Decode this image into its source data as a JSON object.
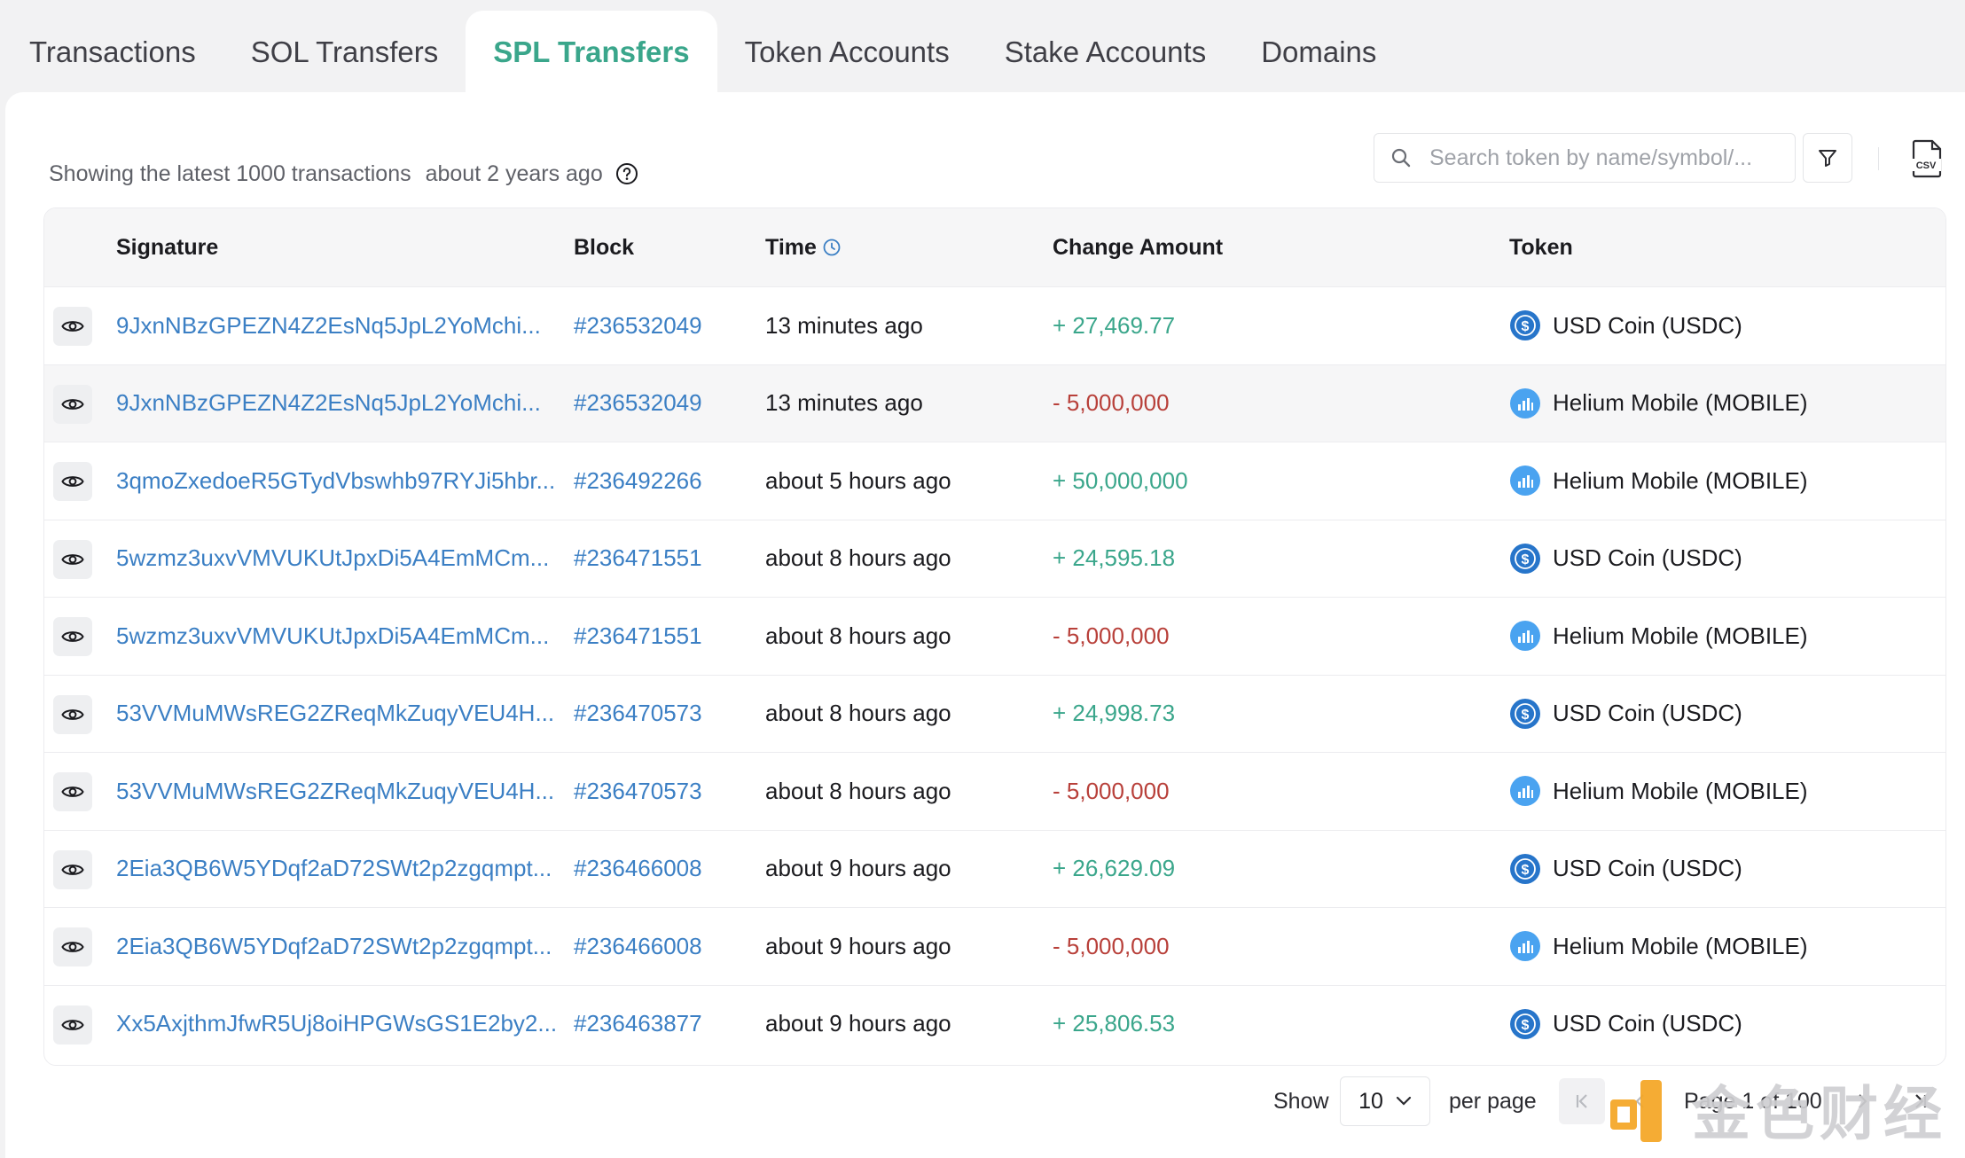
{
  "tabs": [
    {
      "label": "Transactions",
      "active": false
    },
    {
      "label": "SOL Transfers",
      "active": false
    },
    {
      "label": "SPL Transfers",
      "active": true
    },
    {
      "label": "Token Accounts",
      "active": false
    },
    {
      "label": "Stake Accounts",
      "active": false
    },
    {
      "label": "Domains",
      "active": false
    }
  ],
  "info": {
    "showing_text": "Showing the latest 1000 transactions",
    "ago_text": "about 2 years ago"
  },
  "search": {
    "placeholder": "Search token by name/symbol/..."
  },
  "table": {
    "headers": {
      "signature": "Signature",
      "block": "Block",
      "time": "Time",
      "change_amount": "Change Amount",
      "token": "Token"
    },
    "rows": [
      {
        "signature": "9JxnNBzGPEZN4Z2EsNq5JpL2YoMchi...",
        "block": "#236532049",
        "time": "13 minutes ago",
        "change": "+ 27,469.77",
        "direction": "positive",
        "token": "USD Coin (USDC)",
        "token_icon": "usdc-icon"
      },
      {
        "signature": "9JxnNBzGPEZN4Z2EsNq5JpL2YoMchi...",
        "block": "#236532049",
        "time": "13 minutes ago",
        "change": "- 5,000,000",
        "direction": "negative",
        "token": "Helium Mobile (MOBILE)",
        "token_icon": "helium-mobile-icon"
      },
      {
        "signature": "3qmoZxedoeR5GTydVbswhb97RYJi5hbr...",
        "block": "#236492266",
        "time": "about 5 hours ago",
        "change": "+ 50,000,000",
        "direction": "positive",
        "token": "Helium Mobile (MOBILE)",
        "token_icon": "helium-mobile-icon"
      },
      {
        "signature": "5wzmz3uxvVMVUKUtJpxDi5A4EmMCm...",
        "block": "#236471551",
        "time": "about 8 hours ago",
        "change": "+ 24,595.18",
        "direction": "positive",
        "token": "USD Coin (USDC)",
        "token_icon": "usdc-icon"
      },
      {
        "signature": "5wzmz3uxvVMVUKUtJpxDi5A4EmMCm...",
        "block": "#236471551",
        "time": "about 8 hours ago",
        "change": "- 5,000,000",
        "direction": "negative",
        "token": "Helium Mobile (MOBILE)",
        "token_icon": "helium-mobile-icon"
      },
      {
        "signature": "53VVMuMWsREG2ZReqMkZuqyVEU4H...",
        "block": "#236470573",
        "time": "about 8 hours ago",
        "change": "+ 24,998.73",
        "direction": "positive",
        "token": "USD Coin (USDC)",
        "token_icon": "usdc-icon"
      },
      {
        "signature": "53VVMuMWsREG2ZReqMkZuqyVEU4H...",
        "block": "#236470573",
        "time": "about 8 hours ago",
        "change": "- 5,000,000",
        "direction": "negative",
        "token": "Helium Mobile (MOBILE)",
        "token_icon": "helium-mobile-icon"
      },
      {
        "signature": "2Eia3QB6W5YDqf2aD72SWt2p2zgqmpt...",
        "block": "#236466008",
        "time": "about 9 hours ago",
        "change": "+ 26,629.09",
        "direction": "positive",
        "token": "USD Coin (USDC)",
        "token_icon": "usdc-icon"
      },
      {
        "signature": "2Eia3QB6W5YDqf2aD72SWt2p2zgqmpt...",
        "block": "#236466008",
        "time": "about 9 hours ago",
        "change": "- 5,000,000",
        "direction": "negative",
        "token": "Helium Mobile (MOBILE)",
        "token_icon": "helium-mobile-icon"
      },
      {
        "signature": "Xx5AxjthmJfwR5Uj8oiHPGWsGS1E2by2...",
        "block": "#236463877",
        "time": "about 9 hours ago",
        "change": "+ 25,806.53",
        "direction": "positive",
        "token": "USD Coin (USDC)",
        "token_icon": "usdc-icon"
      }
    ]
  },
  "pagination": {
    "show_label": "Show",
    "per_page_value": "10",
    "per_page_label": "per page",
    "page_text": "Page 1 of 100"
  },
  "watermark": {
    "text": "金色财经"
  },
  "colors": {
    "accent": "#3aa68b",
    "link": "#3b7fc4",
    "positive": "#3aa68b",
    "negative": "#b8403a",
    "usdc": "#2775ca",
    "mobile": "#4aa3f0"
  }
}
